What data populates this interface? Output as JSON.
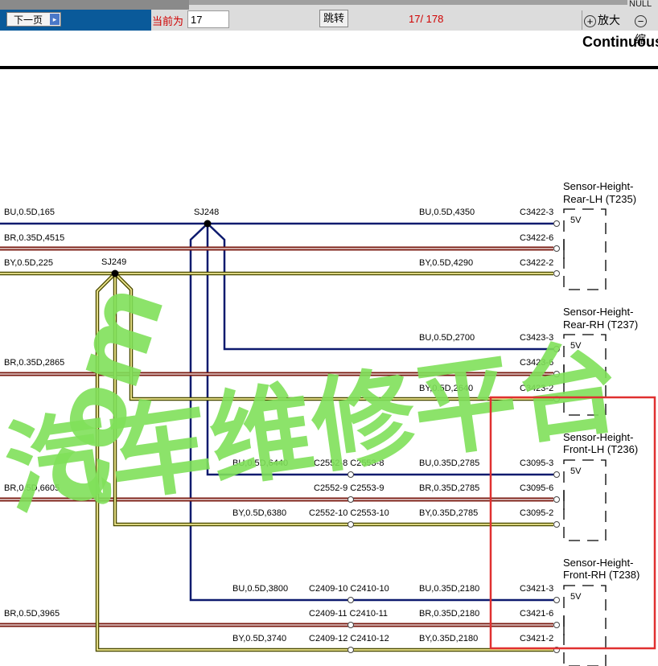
{
  "toolbar": {
    "next_page_label": "下一页",
    "current_label": "当前为",
    "page_value": "17",
    "jump_label": "跳转",
    "page_count": "17/ 178",
    "null_text": "NULL",
    "zoom_in_label": "放大",
    "zoom_out_label": "缩"
  },
  "header": {
    "title": "Continuous"
  },
  "splices": {
    "sj248": "SJ248",
    "sj249": "SJ249"
  },
  "wire_labels": {
    "w1": "BU,0.5D,165",
    "w2": "BR,0.35D,4515",
    "w3": "BY,0.5D,225",
    "w4": "BR,0.35D,2865",
    "w5": "BR,0.5D,6605",
    "w6": "BR,0.5D,3965",
    "r1": "BU,0.5D,4350",
    "r2": "BY,0.5D,4290",
    "r3": "BU,0.5D,2700",
    "r4": "BY,0.5D,2640",
    "f1": "BU,0.35D,2785",
    "f2": "BR,0.35D,2785",
    "f3": "BY,0.35D,2785",
    "g1": "BU,0.35D,2180",
    "g2": "BR,0.35D,2180",
    "g3": "BY,0.35D,2180",
    "m1": "BU,0.5D,6440",
    "m2": "BY,0.5D,6380",
    "m3": "BU,0.5D,3800",
    "m4": "BY,0.5D,3740"
  },
  "connectors": {
    "c1": "C2552-8 C2553-8",
    "c2": "C2552-9 C2553-9",
    "c3": "C2552-10 C2553-10",
    "c4": "C2409-10 C2410-10",
    "c5": "C2409-11 C2410-11",
    "c6": "C2409-12 C2410-12"
  },
  "pins": {
    "p1": "C3422-3",
    "p2": "C3422-6",
    "p3": "C3422-2",
    "p4": "C3423-3",
    "p5": "C3423-6",
    "p6": "C3423-2",
    "p7": "C3095-3",
    "p8": "C3095-6",
    "p9": "C3095-2",
    "p10": "C3421-3",
    "p11": "C3421-6",
    "p12": "C3421-2"
  },
  "sensors": {
    "rear_lh": {
      "line1": "Sensor-Height-",
      "line2": "Rear-LH (T235)",
      "voltage": "5V"
    },
    "rear_rh": {
      "line1": "Sensor-Height-",
      "line2": "Rear-RH (T237)",
      "voltage": "5V"
    },
    "front_lh": {
      "line1": "Sensor-Height-",
      "line2": "Front-LH (T236)",
      "voltage": "5V"
    },
    "front_rh": {
      "line1": "Sensor-Height-",
      "line2": "Front-RH (T238)",
      "voltage": "5V"
    }
  },
  "watermark": {
    "text": "汽车维修平台",
    "prefix": "com"
  },
  "colors": {
    "blue_wire": "#0d1a6e",
    "brown_wire": "#7a1a10",
    "yellow_wire": "#e8e070",
    "highlight_box": "#e03030",
    "watermark": "#7fe05a"
  }
}
